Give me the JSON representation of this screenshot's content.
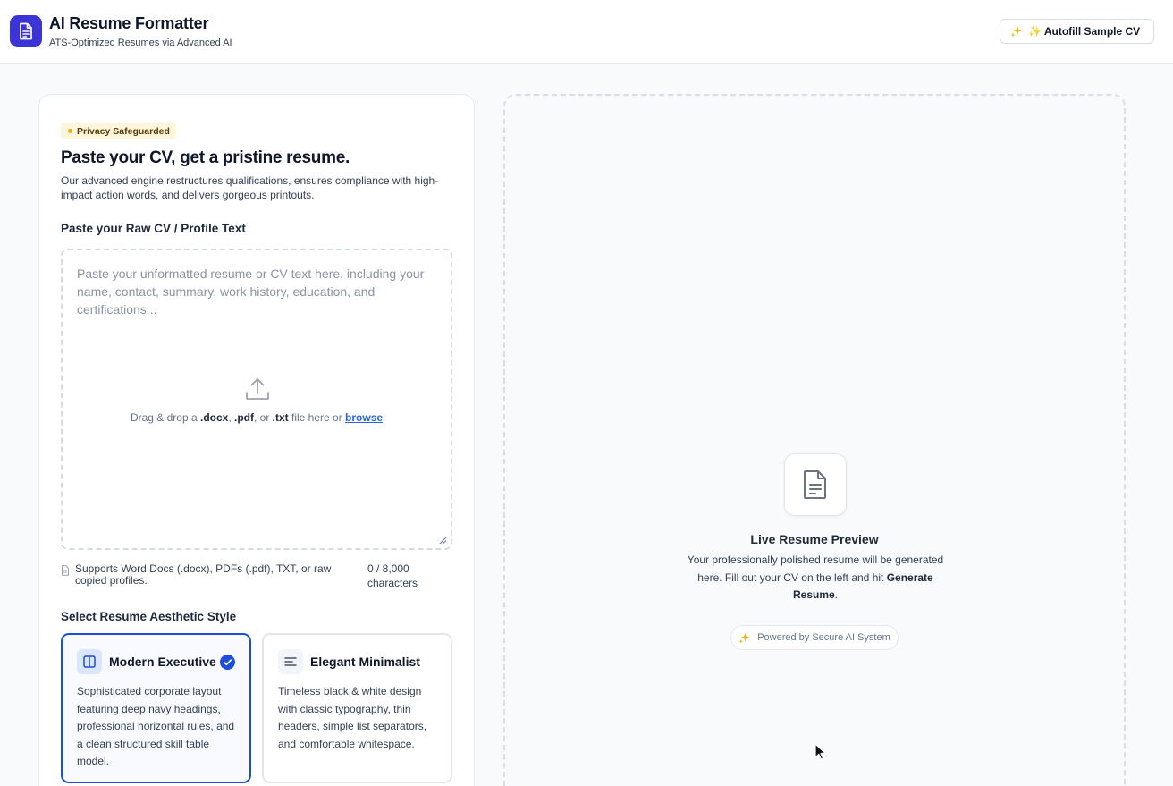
{
  "header": {
    "title": "AI Resume Formatter",
    "subtitle": "ATS-Optimized Resumes via Advanced AI",
    "logo_icon": "document-icon",
    "autofill_label": "✨ Autofill Sample CV",
    "autofill_icon": "sparkles-icon"
  },
  "form": {
    "privacy_badge": "Privacy Safeguarded",
    "heading": "Paste your CV, get a pristine resume.",
    "description": "Our advanced engine restructures qualifications, ensures compliance with high-impact action words, and delivers gorgeous printouts.",
    "cv_label": "Paste your Raw CV / Profile Text",
    "cv_value": "",
    "cv_placeholder": "Paste your unformatted resume or CV text here, including your name, contact, summary, work history, education, and certifications...",
    "drop": {
      "prefix": "Drag & drop a ",
      "ext_docx": ".docx",
      "sep1": ", ",
      "ext_pdf": ".pdf",
      "sep2": ", or ",
      "ext_txt": ".txt",
      "middle": " file here or ",
      "browse": "browse"
    },
    "support_text": "Supports Word Docs (.docx), PDFs (.pdf), TXT, or raw copied profiles.",
    "char_count": "0 / 8,000 characters",
    "style_label": "Select Resume Aesthetic Style",
    "styles": [
      {
        "title": "Modern Executive",
        "description": "Sophisticated corporate layout featuring deep navy headings, professional horizontal rules, and a clean structured skill table model.",
        "selected": true,
        "icon": "columns-icon"
      },
      {
        "title": "Elegant Minimalist",
        "description": "Timeless black & white design with classic typography, thin headers, simple list separators, and comfortable whitespace.",
        "selected": false,
        "icon": "align-left-icon"
      }
    ]
  },
  "preview": {
    "title": "Live Resume Preview",
    "desc_prefix": "Your professionally polished resume will be generated here. Fill out your CV on the left and hit ",
    "desc_bold": "Generate Resume",
    "desc_suffix": ".",
    "powered": "Powered by Secure AI System"
  },
  "colors": {
    "brand": "#3b35d6",
    "accent_blue": "#1d4ed8",
    "badge_bg": "#fef6dc",
    "badge_dot": "#eab308",
    "sparkle": "#eab308"
  }
}
